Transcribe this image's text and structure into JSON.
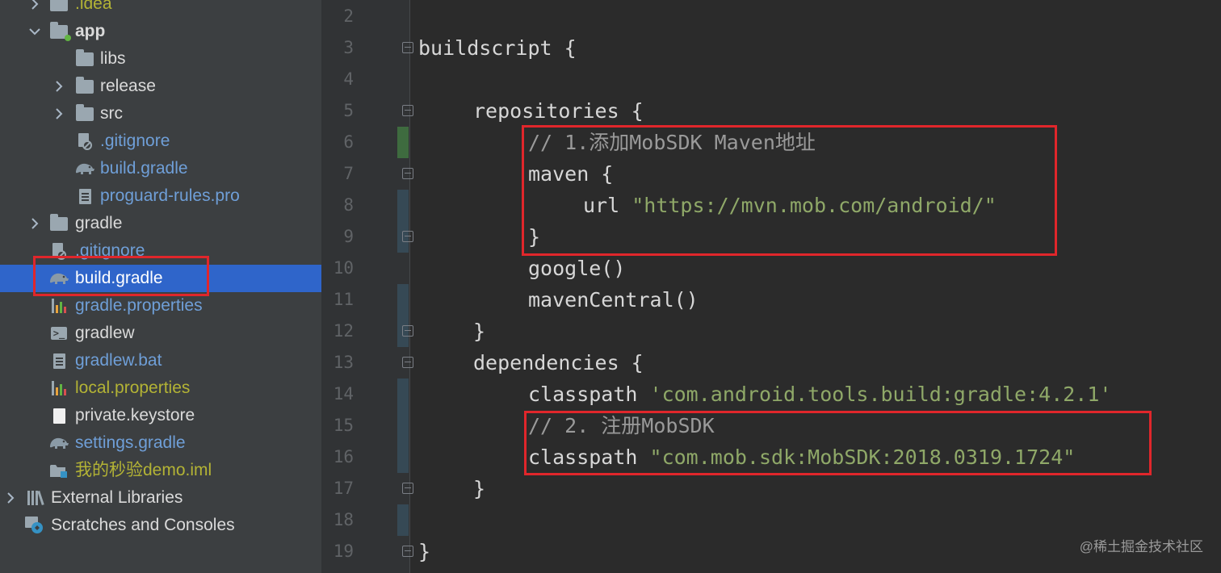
{
  "project_tree": {
    "items": [
      {
        "label": ".idea",
        "kind": "folder",
        "color": "olive",
        "expandable": "collapsed",
        "indent": 1
      },
      {
        "label": "app",
        "kind": "module-folder",
        "color": "white",
        "expandable": "expanded",
        "indent": 1,
        "bold": true
      },
      {
        "label": "libs",
        "kind": "folder",
        "color": "white",
        "expandable": "none",
        "indent": 2
      },
      {
        "label": "release",
        "kind": "folder",
        "color": "white",
        "expandable": "collapsed",
        "indent": 2
      },
      {
        "label": "src",
        "kind": "folder",
        "color": "white",
        "expandable": "collapsed",
        "indent": 2
      },
      {
        "label": ".gitignore",
        "kind": "gitignore",
        "color": "blue",
        "expandable": "none",
        "indent": 2
      },
      {
        "label": "build.gradle",
        "kind": "gradle",
        "color": "blue",
        "expandable": "none",
        "indent": 2
      },
      {
        "label": "proguard-rules.pro",
        "kind": "doc",
        "color": "blue",
        "expandable": "none",
        "indent": 2
      },
      {
        "label": "gradle",
        "kind": "folder",
        "color": "white",
        "expandable": "collapsed",
        "indent": 1
      },
      {
        "label": ".gitignore",
        "kind": "gitignore",
        "color": "blue",
        "expandable": "none",
        "indent": 1
      },
      {
        "label": "build.gradle",
        "kind": "gradle",
        "color": "white",
        "expandable": "none",
        "indent": 1,
        "selected": true
      },
      {
        "label": "gradle.properties",
        "kind": "properties",
        "color": "blue",
        "expandable": "none",
        "indent": 1
      },
      {
        "label": "gradlew",
        "kind": "terminal",
        "color": "white",
        "expandable": "none",
        "indent": 1
      },
      {
        "label": "gradlew.bat",
        "kind": "doc",
        "color": "blue",
        "expandable": "none",
        "indent": 1
      },
      {
        "label": "local.properties",
        "kind": "properties",
        "color": "olive",
        "expandable": "none",
        "indent": 1
      },
      {
        "label": "private.keystore",
        "kind": "white-doc",
        "color": "white",
        "expandable": "none",
        "indent": 1
      },
      {
        "label": "settings.gradle",
        "kind": "gradle",
        "color": "blue",
        "expandable": "none",
        "indent": 1
      },
      {
        "label": "我的秒验demo.iml",
        "kind": "iml",
        "color": "olive",
        "expandable": "none",
        "indent": 1
      },
      {
        "label": "External Libraries",
        "kind": "libraries",
        "color": "white",
        "expandable": "collapsed",
        "indent": 0
      },
      {
        "label": "Scratches and Consoles",
        "kind": "scratches",
        "color": "white",
        "expandable": "none",
        "indent": 0
      }
    ]
  },
  "editor": {
    "line_numbers": [
      "2",
      "3",
      "4",
      "5",
      "6",
      "7",
      "8",
      "9",
      "10",
      "11",
      "12",
      "13",
      "14",
      "15",
      "16",
      "17",
      "18",
      "19"
    ],
    "lines": [
      {
        "num": "2",
        "indent": 0,
        "tokens": []
      },
      {
        "num": "3",
        "indent": 0,
        "tokens": [
          {
            "t": "kw",
            "v": "buildscript {"
          }
        ]
      },
      {
        "num": "4",
        "indent": 0,
        "tokens": []
      },
      {
        "num": "5",
        "indent": 1,
        "tokens": [
          {
            "t": "kw",
            "v": "repositories {"
          }
        ]
      },
      {
        "num": "6",
        "indent": 2,
        "tokens": [
          {
            "t": "cm",
            "v": "// 1.添加MobSDK Maven地址"
          }
        ]
      },
      {
        "num": "7",
        "indent": 2,
        "tokens": [
          {
            "t": "kw",
            "v": "maven {"
          }
        ]
      },
      {
        "num": "8",
        "indent": 3,
        "tokens": [
          {
            "t": "kw",
            "v": "url "
          },
          {
            "t": "str",
            "v": "\"https://mvn.mob.com/android/\""
          }
        ]
      },
      {
        "num": "9",
        "indent": 2,
        "tokens": [
          {
            "t": "kw",
            "v": "}"
          }
        ]
      },
      {
        "num": "10",
        "indent": 2,
        "tokens": [
          {
            "t": "kw",
            "v": "google()"
          }
        ]
      },
      {
        "num": "11",
        "indent": 2,
        "tokens": [
          {
            "t": "kw",
            "v": "mavenCentral()"
          }
        ]
      },
      {
        "num": "12",
        "indent": 1,
        "tokens": [
          {
            "t": "kw",
            "v": "}"
          }
        ]
      },
      {
        "num": "13",
        "indent": 1,
        "tokens": [
          {
            "t": "kw",
            "v": "dependencies {"
          }
        ]
      },
      {
        "num": "14",
        "indent": 2,
        "tokens": [
          {
            "t": "kw",
            "v": "classpath "
          },
          {
            "t": "str",
            "v": "'com.android.tools.build:gradle:4.2.1'"
          }
        ]
      },
      {
        "num": "15",
        "indent": 2,
        "tokens": [
          {
            "t": "cm",
            "v": "// 2. 注册MobSDK"
          }
        ]
      },
      {
        "num": "16",
        "indent": 2,
        "tokens": [
          {
            "t": "kw",
            "v": "classpath "
          },
          {
            "t": "str",
            "v": "\"com.mob.sdk:MobSDK:2018.0319.1724\""
          }
        ]
      },
      {
        "num": "17",
        "indent": 1,
        "tokens": [
          {
            "t": "kw",
            "v": "}"
          }
        ]
      },
      {
        "num": "18",
        "indent": 0,
        "tokens": []
      },
      {
        "num": "19",
        "indent": 0,
        "tokens": [
          {
            "t": "kw",
            "v": "}"
          }
        ]
      }
    ]
  },
  "colors": {
    "tree_bg": "#3c3f41",
    "editor_bg": "#2b2b2b",
    "selection": "#2f65ca",
    "highlight_box": "#e0262b",
    "string": "#8fa868",
    "comment": "#9a9a9a"
  },
  "watermark": "@稀土掘金技术社区"
}
